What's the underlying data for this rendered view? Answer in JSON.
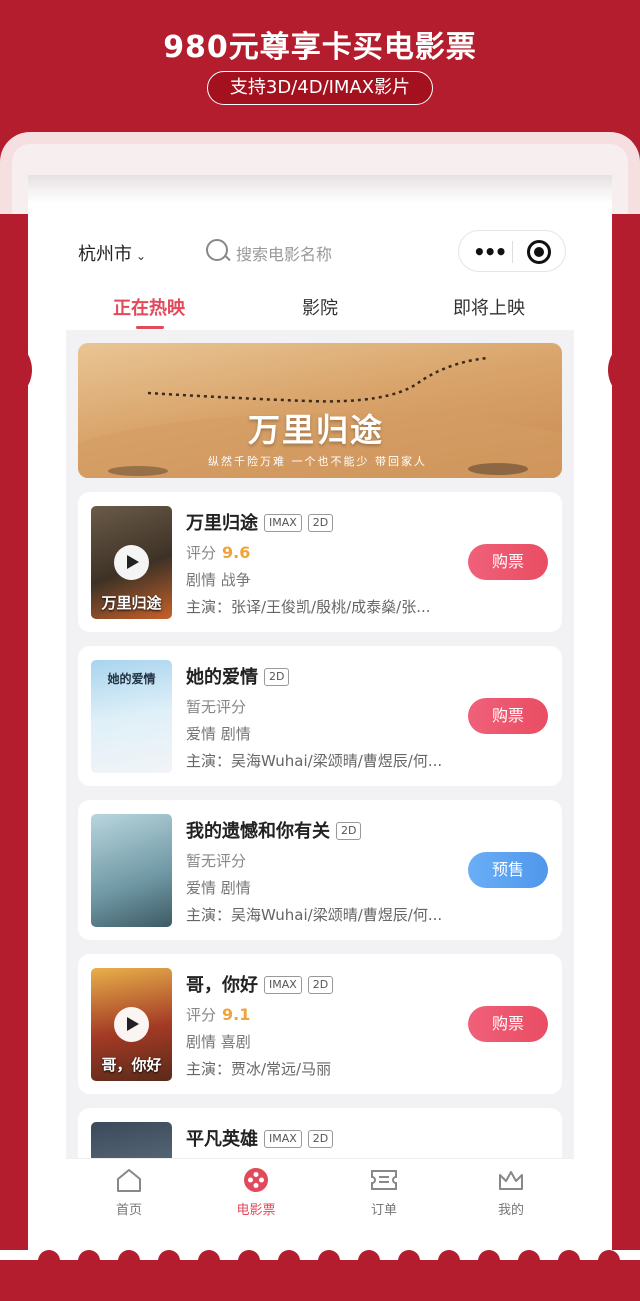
{
  "promo": {
    "title": "980元尊享卡买电影票",
    "subtitle": "支持3D/4D/IMAX影片"
  },
  "header": {
    "city": "杭州市",
    "search_placeholder": "搜索电影名称",
    "menu_icon": "more-dots-icon",
    "close_icon": "record-icon"
  },
  "tabs": [
    {
      "label": "正在热映",
      "active": true
    },
    {
      "label": "影院",
      "active": false
    },
    {
      "label": "即将上映",
      "active": false
    }
  ],
  "banner": {
    "title": "万里归途",
    "subtitle": "纵然千险万难 一个也不能少 带回家人"
  },
  "movies": [
    {
      "title": "万里归途",
      "tags": [
        "IMAX",
        "2D"
      ],
      "score_label": "评分",
      "score": "9.6",
      "genre": "剧情 战争",
      "cast": "主演：张译/王俊凯/殷桃/成泰燊/张...",
      "button": "购票",
      "poster_text": "万里归途",
      "has_trailer": true
    },
    {
      "title": "她的爱情",
      "tags": [
        "2D"
      ],
      "score_label": "暂无评分",
      "score": "",
      "genre": "爱情 剧情",
      "cast": "主演：吴海Wuhai/梁颂晴/曹煜辰/何...",
      "button": "购票",
      "poster_text": "她的爱情",
      "has_trailer": false
    },
    {
      "title": "我的遗憾和你有关",
      "tags": [
        "2D"
      ],
      "score_label": "暂无评分",
      "score": "",
      "genre": "爱情 剧情",
      "cast": "主演：吴海Wuhai/梁颂晴/曹煜辰/何...",
      "button": "预售",
      "poster_text": "",
      "has_trailer": false
    },
    {
      "title": "哥，你好",
      "tags": [
        "IMAX",
        "2D"
      ],
      "score_label": "评分",
      "score": "9.1",
      "genre": "剧情 喜剧",
      "cast": "主演：贾冰/常远/马丽",
      "button": "购票",
      "poster_text": "哥，你好",
      "has_trailer": true
    },
    {
      "title": "平凡英雄",
      "tags": [
        "IMAX",
        "2D"
      ],
      "score_label": "",
      "score": "",
      "genre": "",
      "cast": "",
      "button": "",
      "poster_text": "",
      "has_trailer": false
    }
  ],
  "bottom_nav": [
    {
      "label": "首页",
      "icon": "home-icon",
      "active": false
    },
    {
      "label": "电影票",
      "icon": "film-reel-icon",
      "active": true
    },
    {
      "label": "订单",
      "icon": "ticket-icon",
      "active": false
    },
    {
      "label": "我的",
      "icon": "crown-icon",
      "active": false
    }
  ],
  "colors": {
    "background": "#b31d2d",
    "accent": "#e24a5c",
    "score": "#f0a33a",
    "presale": "#4f97ec"
  }
}
